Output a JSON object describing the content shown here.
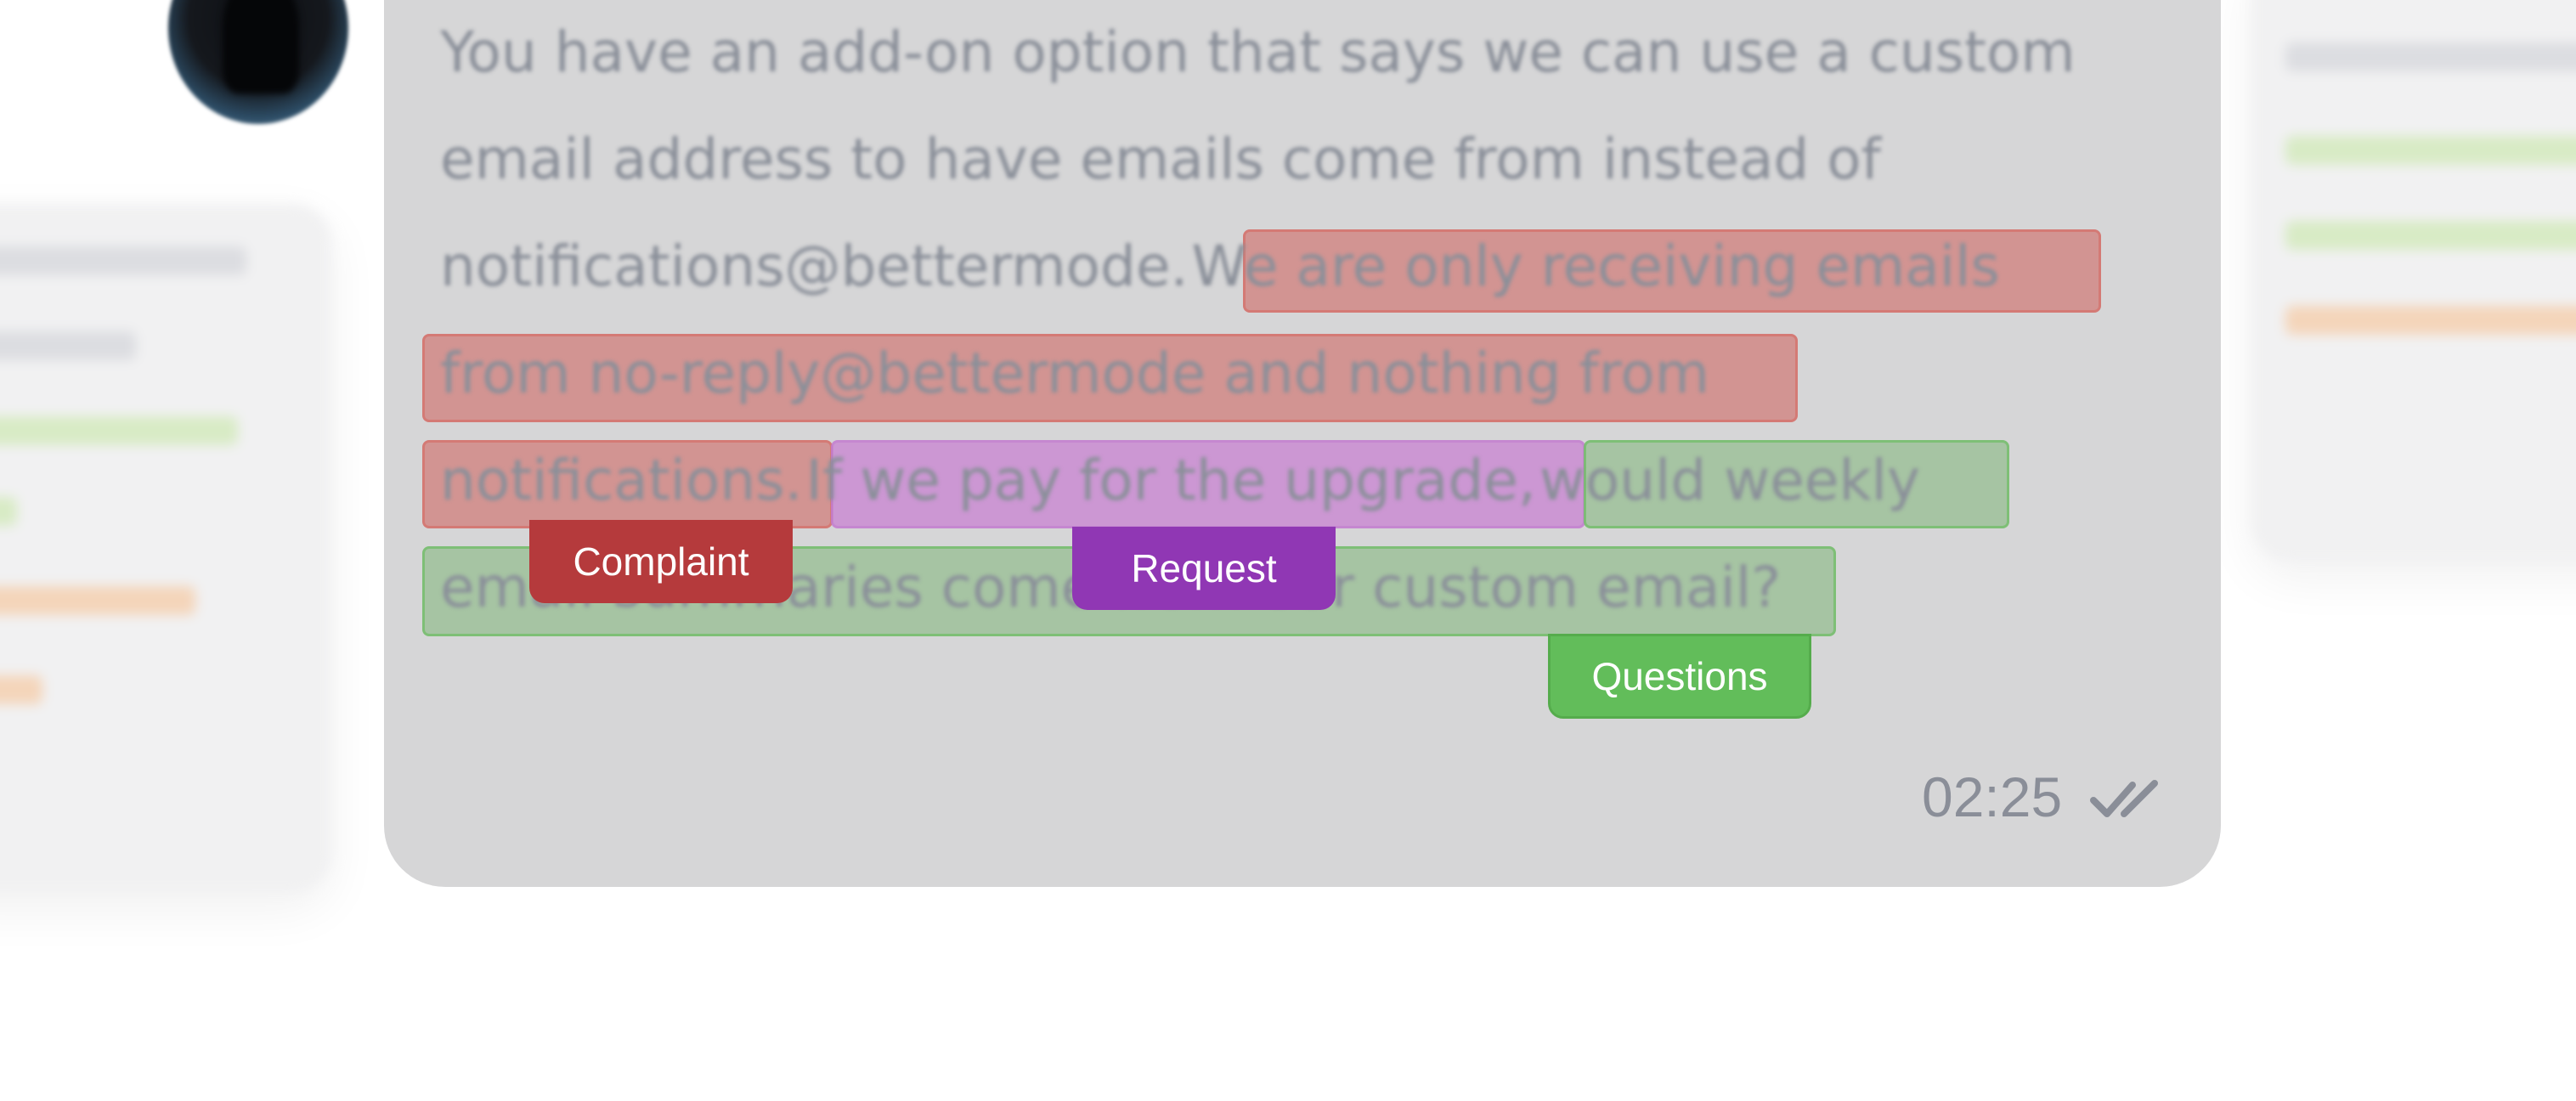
{
  "message": {
    "lines": [
      "You have an add-on option that says we can use a custom",
      "email address to have emails come from instead of",
      "notifications@bettermode.",
      "We are only receiving emails",
      "from no-reply@bettermode and nothing from",
      "notifications.",
      "If we pay for the upgrade,",
      "would weekly",
      "email summaries come from our custom email?"
    ],
    "time": "02:25",
    "status_icon": "double-check-icon"
  },
  "annotations": {
    "complaint": "Complaint",
    "request": "Request",
    "questions": "Questions"
  },
  "colors": {
    "complaint": "#b53a3c",
    "request": "#9037b4",
    "questions": "#62bd5a",
    "bubble": "#d6d6d7"
  }
}
